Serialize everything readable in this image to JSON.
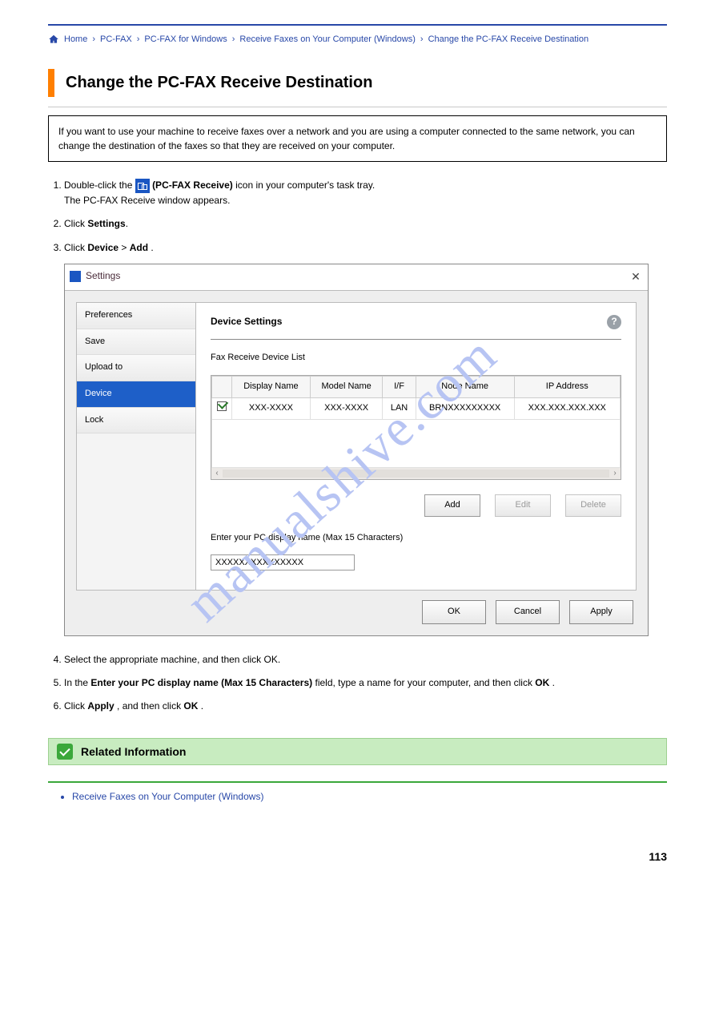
{
  "topbar": {
    "crumbs": [
      "Home",
      "PC-FAX",
      "PC-FAX for Windows",
      "Receive Faxes on Your Computer (Windows)",
      "Change the PC-FAX Receive Destination"
    ]
  },
  "heading": "Change the PC-FAX Receive Destination",
  "note_box": "If you want to use your machine to receive faxes over a network and you are using a computer connected to the same network, you can change the destination of the faxes so that they are received on your computer.",
  "steps": {
    "s1_pre": "Double-click the  ",
    "s1_mid": "(PC-FAX Receive)",
    "s1_post": " icon in your computer's task tray.",
    "s1_sub": "The PC-FAX Receive window appears.",
    "s2": "Click Settings.",
    "s2_bold": "Settings",
    "s3_pre": "Click ",
    "s3_b1": "Device",
    "s3_mid": " > ",
    "s3_b2": "Add",
    "s3_post": ".",
    "s4": "Select the appropriate machine, and then click OK.",
    "s5_pre": "In the ",
    "s5_b1": "Enter your PC display name (Max 15 Characters)",
    "s5_mid": " field, type a name for your computer, and then click ",
    "s5_b2": "OK",
    "s5_post": ".",
    "s6_pre": "Click ",
    "s6_b1": "Apply",
    "s6_mid": ", and then click ",
    "s6_b2": "OK",
    "s6_post": "."
  },
  "window": {
    "title": "Settings",
    "sidebar": [
      "Preferences",
      "Save",
      "Upload to",
      "Device",
      "Lock"
    ],
    "pane_title": "Device Settings",
    "pane_sub": "Fax Receive Device List",
    "table": {
      "headers": [
        "Display Name",
        "Model Name",
        "I/F",
        "Node Name",
        "IP Address"
      ],
      "row": {
        "display": "XXX-XXXX",
        "model": "XXX-XXXX",
        "if": "LAN",
        "node": "BRNXXXXXXXXX",
        "ip": "XXX.XXX.XXX.XXX"
      }
    },
    "btns": {
      "add": "Add",
      "edit": "Edit",
      "delete": "Delete"
    },
    "input_label": "Enter your PC display name (Max 15 Characters)",
    "input_value": "XXXXXXXXXXXXXXX",
    "bottom": {
      "ok": "OK",
      "cancel": "Cancel",
      "apply": "Apply"
    }
  },
  "related": {
    "title": "Related Information",
    "item": "Receive Faxes on Your Computer (Windows)"
  },
  "watermark": "manualshive.com",
  "page_number": "113"
}
